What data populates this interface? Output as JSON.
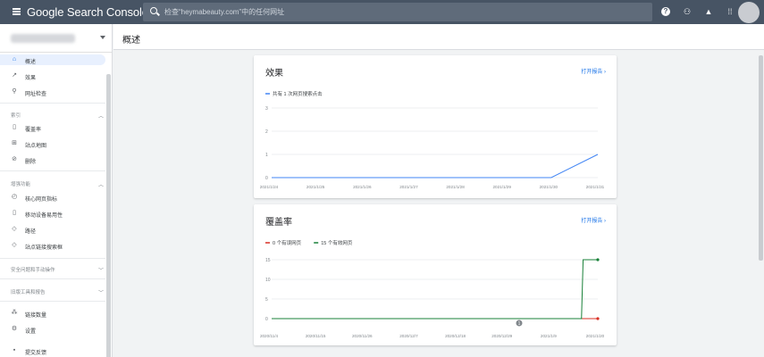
{
  "topbar": {
    "brand": "Google Search Console",
    "search_placeholder": "检查“heymabeauty.com”中的任何网址"
  },
  "page": {
    "title": "概述"
  },
  "sidebar": {
    "items_top": [
      {
        "label": "概述",
        "icon": "home-icon"
      },
      {
        "label": "效果",
        "icon": "trending-up-icon"
      },
      {
        "label": "网址检查",
        "icon": "search-icon"
      }
    ],
    "section_index": "索引",
    "items_index": [
      {
        "label": "覆盖率",
        "icon": "file-icon"
      },
      {
        "label": "站点地图",
        "icon": "sitemap-icon"
      },
      {
        "label": "删除",
        "icon": "eye-off-icon"
      }
    ],
    "section_enhance": "增强功能",
    "items_enhance": [
      {
        "label": "核心网页指标",
        "icon": "speed-icon"
      },
      {
        "label": "移动设备易用性",
        "icon": "phone-icon"
      },
      {
        "label": "路径",
        "icon": "layers-icon"
      },
      {
        "label": "站点链接搜索框",
        "icon": "layers-icon"
      }
    ],
    "section_security": "安全问题和手动操作",
    "section_legacy": "旧版工具和报告",
    "items_bottom": [
      {
        "label": "链接数量",
        "icon": "links-icon"
      },
      {
        "label": "设置",
        "icon": "gear-icon"
      },
      {
        "label": "提交反馈",
        "icon": "feedback-icon"
      }
    ]
  },
  "cards": {
    "performance": {
      "title": "效果",
      "link": "打开报告"
    },
    "coverage": {
      "title": "覆盖率",
      "link": "打开报告"
    }
  },
  "colors": {
    "accent": "#1a73e8",
    "error": "#d93025",
    "valid": "#188038"
  },
  "chart_data": [
    {
      "type": "line",
      "title": "效果",
      "legend": "top-left",
      "series": [
        {
          "name": "共有 1 次网页搜索点击",
          "color": "#4285f4",
          "x": [
            "2021/1/24",
            "2021/1/25",
            "2021/1/26",
            "2021/1/27",
            "2021/1/28",
            "2021/1/29",
            "2021/1/30",
            "2021/1/31"
          ],
          "values": [
            0,
            0,
            0,
            0,
            0,
            0,
            0,
            1
          ]
        }
      ],
      "x_ticks": [
        "2021/1/24",
        "2021/1/25",
        "2021/1/26",
        "2021/1/27",
        "2021/1/28",
        "2021/1/29",
        "2021/1/30",
        "2021/1/31"
      ],
      "y_ticks": [
        "3",
        "2",
        "1",
        "0"
      ],
      "ylim": [
        0,
        3
      ],
      "grid": true
    },
    {
      "type": "line",
      "title": "覆盖率",
      "legend": "top-left",
      "series": [
        {
          "name": "0 个有误网页",
          "color": "#d93025",
          "values": [
            0,
            0,
            0,
            0,
            0,
            0,
            0,
            0,
            0,
            0,
            0
          ]
        },
        {
          "name": "15 个有效网页",
          "color": "#188038",
          "values": [
            0,
            0,
            0,
            0,
            0,
            0,
            0,
            0,
            0,
            15,
            15
          ]
        }
      ],
      "x_ticks": [
        "2020/11/4",
        "2020/11/15",
        "2020/11/26",
        "2020/12/7",
        "2020/12/18",
        "2020/12/29",
        "2021/1/9",
        "2021/1/20"
      ],
      "y_ticks": [
        "15",
        "10",
        "5",
        "0"
      ],
      "ylim": [
        0,
        15
      ],
      "annotation": "1",
      "grid": true
    }
  ]
}
